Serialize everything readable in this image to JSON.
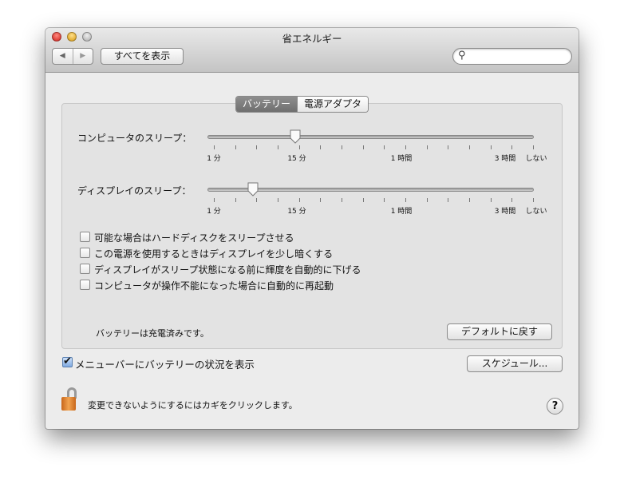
{
  "window": {
    "title": "省エネルギー"
  },
  "toolbar": {
    "show_all": "すべてを表示",
    "search_placeholder": ""
  },
  "tabs": [
    {
      "label": "バッテリー",
      "selected": true
    },
    {
      "label": "電源アダプタ",
      "selected": false
    }
  ],
  "sliders": [
    {
      "label": "コンピュータのスリープ：",
      "value_fraction": 0.27
    },
    {
      "label": "ディスプレイのスリープ：",
      "value_fraction": 0.14
    }
  ],
  "tick_labels": [
    "1 分",
    "15 分",
    "1 時間",
    "3 時間",
    "しない"
  ],
  "options": [
    {
      "label": "可能な場合はハードディスクをスリープさせる",
      "checked": false
    },
    {
      "label": "この電源を使用するときはディスプレイを少し暗くする",
      "checked": false
    },
    {
      "label": "ディスプレイがスリープ状態になる前に輝度を自動的に下げる",
      "checked": false
    },
    {
      "label": "コンピュータが操作不能になった場合に自動的に再起動",
      "checked": false
    }
  ],
  "status": "バッテリーは充電済みです。",
  "default_button": "デフォルトに戻す",
  "menubar_option": {
    "label": "メニューバーにバッテリーの状況を表示",
    "checked": true
  },
  "schedule_button": "スケジュール...",
  "lock_text": "変更できないようにするにはカギをクリックします。",
  "help": "?"
}
